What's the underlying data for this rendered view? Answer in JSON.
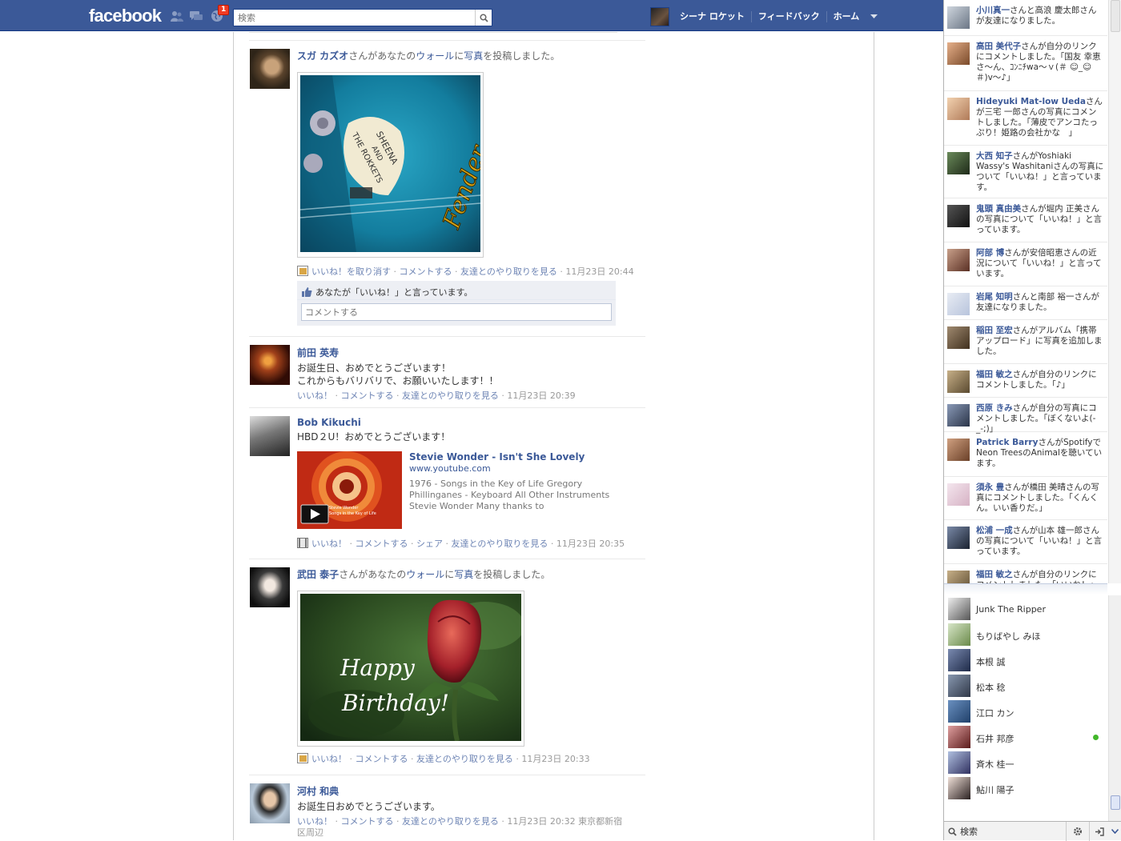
{
  "header": {
    "logo": "facebook",
    "notif_count": "1",
    "search_placeholder": "検索",
    "user_name": "シーナ ロケット",
    "links": [
      "フィードバック",
      "ホーム"
    ]
  },
  "stories": [
    {
      "actor": "スガ カズオ",
      "message_parts": [
        "さんがあなたの",
        "ウォール",
        "に",
        "写真",
        "を投稿しました。"
      ],
      "photo_text": [
        "SHEENA",
        "AND",
        "THE ROKKETS",
        "Fender"
      ],
      "actions": [
        "いいね！を取り消す",
        "コメントする",
        "友達とのやり取りを見る"
      ],
      "time": "11月23日 20:44",
      "likes_text": "あなたが「いいね！」と言っています。",
      "comment_placeholder": "コメントする"
    },
    {
      "actor": "前田 英寿",
      "message": [
        "お誕生日、おめでとうございます！",
        "これからもバリバリで、お願いいたします！！"
      ],
      "actions": [
        "いいね！",
        "コメントする",
        "友達とのやり取りを見る"
      ],
      "time": "11月23日 20:39"
    },
    {
      "actor": "Bob Kikuchi",
      "message": [
        "HBD２U！おめでとうございます！"
      ],
      "link": {
        "title": "Stevie Wonder - Isn't She Lovely",
        "url": "www.youtube.com",
        "desc": "1976 - Songs in the Key of Life Gregory Phillinganes - Keyboard All Other Instruments Stevie Wonder Many thanks to ClosedCaptionIt for the captions! If you'r...",
        "thumb_text": [
          "Stevie Wonder",
          "Songs in the Key of Life"
        ]
      },
      "actions": [
        "いいね！",
        "コメントする",
        "シェア",
        "友達とのやり取りを見る"
      ],
      "time": "11月23日 20:35"
    },
    {
      "actor": "武田 泰子",
      "message_parts": [
        "さんがあなたの",
        "ウォール",
        "に",
        "写真",
        "を投稿しました。"
      ],
      "photo_text": [
        "Happy",
        "Birthday!"
      ],
      "actions": [
        "いいね！",
        "コメントする",
        "友達とのやり取りを見る"
      ],
      "time": "11月23日 20:33"
    },
    {
      "actor": "河村 和典",
      "message": [
        "お誕生日おめでとうございます。"
      ],
      "actions": [
        "いいね！",
        "コメントする",
        "友達とのやり取りを見る"
      ],
      "time": "11月23日 20:32",
      "location": "東京都新宿区周辺"
    }
  ],
  "ticker": [
    {
      "name": "小川真一",
      "text": "さんと高浪 慶太郎さんが友達になりました。"
    },
    {
      "name": "高田 美代子",
      "text": "さんが自分のリンクにコメントしました。「国友 幸恵さ〜ん、ｺﾝﾆﾁwa〜ｖ(＃ ☺_☺＃)v〜♪」"
    },
    {
      "name": "Hideyuki Mat-low Ueda",
      "text": "さんが三宅 一郎さんの写真にコメントしました。「薄皮でアンコたっぷり！姫路の会社かな　」"
    },
    {
      "name": "大西 知子",
      "text": "さんがYoshiaki Wassy's Washitaniさんの写真について「いいね！」と言っています。"
    },
    {
      "name": "鬼頭 真由美",
      "text": "さんが堀内 正美さんの写真について「いいね！」と言っています。"
    },
    {
      "name": "阿部 博",
      "text": "さんが安倍昭恵さんの近況について「いいね！」と言っています。"
    },
    {
      "name": "岩尾 知明",
      "text": "さんと南部 裕一さんが友達になりました。"
    },
    {
      "name": "稲田 至宏",
      "text": "さんがアルバム「携帯アップロード」に写真を追加しました。"
    },
    {
      "name": "福田 敏之",
      "text": "さんが自分のリンクにコメントしました。「♪」"
    },
    {
      "name": "西原 きみ",
      "text": "さんが自分の写真にコメントしました。「ぼくないよ(-_-;)」"
    },
    {
      "name": "Patrick Barry",
      "text": "さんがSpotifyでNeon TreesのAnimalを聴いています。"
    },
    {
      "name": "須永 豊",
      "text": "さんが橋田 美晴さんの写真にコメントしました。「くんくん。いい香りだ。」"
    },
    {
      "name": "松浦 一成",
      "text": "さんが山本 雄一郎さんの写真について「いいね！」と言っています。"
    },
    {
      "name": "福田 敏之",
      "text": "さんが自分のリンクにコメントしました。「いいね！」と言っています。"
    }
  ],
  "chat": {
    "friends": [
      {
        "name": "Junk The Ripper",
        "online": false
      },
      {
        "name": "もりばやし みほ",
        "online": false
      },
      {
        "name": "本根 誠",
        "online": false
      },
      {
        "name": "松本 稔",
        "online": false
      },
      {
        "name": "江口 カン",
        "online": false
      },
      {
        "name": "石井 邦彦",
        "online": true
      },
      {
        "name": "斉木 桂一",
        "online": false
      },
      {
        "name": "鮎川 陽子",
        "online": false
      }
    ],
    "search_placeholder": "検索"
  }
}
